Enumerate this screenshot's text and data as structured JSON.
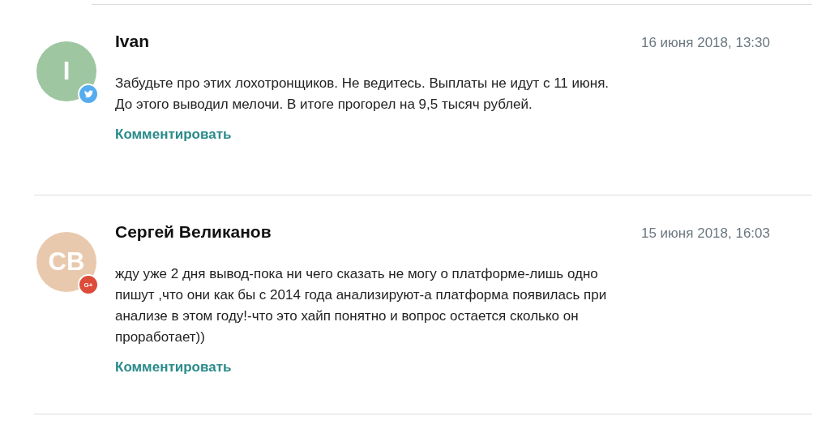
{
  "comments": [
    {
      "author": "Ivan",
      "initials": "I",
      "color": "#9dc6a1",
      "badge": {
        "kind": "twitter"
      },
      "date": "16 июня 2018, 13:30",
      "lines": [
        "Забудьте про этих лохотронщиков. Не ведитесь. Выплаты не идут с 11 июня.",
        "До этого выводил мелочи. В итоге прогорел на 9,5 тысяч рублей."
      ],
      "reply": "Комментировать"
    },
    {
      "author": "Сергей Великанов",
      "initials": "СВ",
      "color": "#e9c9ad",
      "badge": {
        "kind": "google-plus",
        "label": "G+"
      },
      "date": "15 июня 2018, 16:03",
      "lines": [
        "жду уже 2 дня вывод-пока ни чего сказать не могу о платформе-лишь одно",
        "пишут ,что они как бы с 2014 года анализируют-а платформа появилась при",
        "анализе в этом году!-что это хайп понятно и вопрос остается сколько он",
        "проработает))"
      ],
      "reply": "Комментировать"
    }
  ]
}
